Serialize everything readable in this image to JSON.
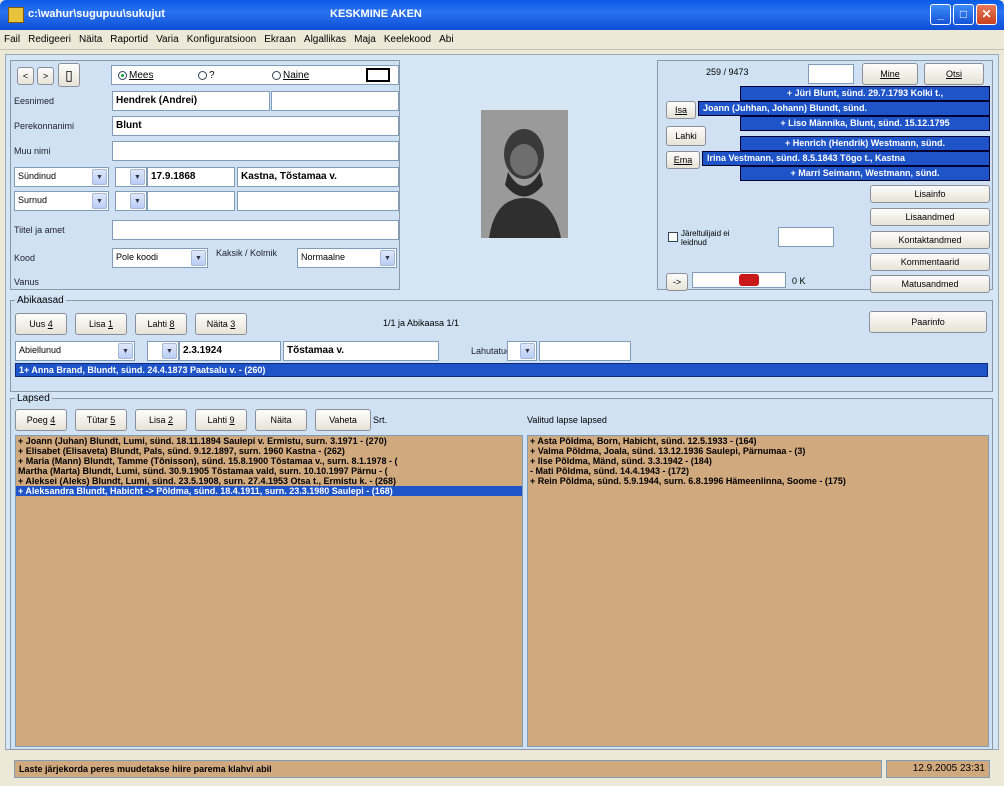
{
  "window": {
    "path": "c:\\wahur\\sugupuu\\sukujut",
    "title": "KESKMINE AKEN",
    "min": "_",
    "max": "□",
    "close": "✕"
  },
  "menu": [
    "Fail",
    "Redigeeri",
    "Näita",
    "Raportid",
    "Varia",
    "Konfiguratsioon",
    "Ekraan",
    "Algallikas",
    "Maja",
    "Keelekood",
    "Abi"
  ],
  "person": {
    "nav_back": "<",
    "nav_fwd": ">",
    "gender_male": "Mees",
    "gender_unknown": "?",
    "gender_female": "Naine",
    "first_names_label": "Eesnimed",
    "first_names": "Hendrek (Andrei)",
    "surname_label": "Perekonnanimi",
    "surname": "Blunt",
    "other_name_label": "Muu nimi",
    "born_combo": "Sündinud",
    "birth_date": "17.9.1868",
    "birth_place": "Kastna, Tõstamaa v.",
    "died_combo": "Surnud",
    "titles_label": "Tiitel ja amet",
    "code_label": "Kood",
    "code_value": "Pole koodi",
    "adopted_label": "Kaksik / Kolmik",
    "adopted_value": "Normaalne",
    "age_label": "Vanus"
  },
  "relatives": {
    "counter": "259 / 9473",
    "go_btn": "Mine",
    "search_btn": "Otsi",
    "father_btn": "Isa",
    "mother_btn": "Ema",
    "spouse_btn": "Lahki",
    "rows": [
      "+ Jüri Blunt, sünd. 29.7.1793 Kolki t.,",
      "Joann (Juhhan, Johann) Blundt, sünd.",
      "+ Liso Männika, Blunt, sünd. 15.12.1795",
      "+ Henrich (Hendrik) Westmann, sünd.",
      "Irina Vestmann, sünd. 8.5.1843 Tõgo t., Kastna",
      "+ Marri Seimann, Westmann, sünd."
    ],
    "no_descendants": "Järeltulijaid ei leidnud",
    "extra_btns": [
      "Lisainfo",
      "Lisaandmed",
      "Kontaktandmed",
      "Kommentaarid",
      "Matusandmed"
    ],
    "arrow": "->",
    "kb": "0 K"
  },
  "marriages": {
    "title": "Abikaasad",
    "new_btn": "Uus",
    "new_key": "4",
    "add_btn": "Lisa",
    "add_key": "1",
    "separate_btn": "Lahti",
    "separate_key": "8",
    "show_btn": "Näita",
    "show_key": "3",
    "status": "1/1 ja Abikaasa 1/1",
    "marital_combo": "Abiellunud",
    "marriage_date": "2.3.1924",
    "marriage_place": "Tõstamaa v.",
    "divorce_label": "Lahutatud",
    "info_btn": "Paarinfo",
    "spouse_row": "1+ Anna Brand, Blundt, sünd. 24.4.1873 Paatsalu v. - (260)"
  },
  "children": {
    "title": "Lapsed",
    "son_btn": "Poeg",
    "son_key": "4",
    "daughter_btn": "Tütar",
    "daughter_key": "5",
    "add_btn": "Lisa",
    "add_key": "2",
    "separate_btn": "Lahti",
    "separate_key": "9",
    "show_btn": "Näita",
    "swap_btn": "Vaheta",
    "swap_suffix": "Srt.",
    "grandchildren_label": "Valitud lapse lapsed",
    "list": [
      "+ Joann (Juhan) Blundt, Lumi, sünd. 18.11.1894 Saulepi v. Ermistu, surn. 3.1971 - (270)",
      "+ Elisabet (Elisaveta) Blundt, Pals, sünd. 9.12.1897, surn. 1960 Kastna - (262)",
      "+ Maria (Mann) Blundt, Tamme (Tõnisson), sünd. 15.8.1900 Tõstamaa v., surn. 8.1.1978 - (",
      "  Martha (Marta) Blundt, Lumi, sünd. 30.9.1905 Tõstamaa vald, surn. 10.10.1997 Pärnu - (",
      "+ Aleksei (Aleks) Blundt, Lumi, sünd. 23.5.1908, surn. 27.4.1953 Otsa t., Ermistu k. - (268)",
      "+ Aleksandra Blundt, Habicht -> Põldma, sünd. 18.4.1911, surn. 23.3.1980 Saulepi - (168)"
    ],
    "grandchildren": [
      "+ Asta Põldma, Born, Habicht, sünd. 12.5.1933 - (164)",
      "+ Valma Põldma, Joala, sünd. 13.12.1936 Saulepi, Pärnumaa - (3)",
      "+ Ilse Põldma, Mänd, sünd. 3.3.1942 - (184)",
      "- Mati Põldma, sünd. 14.4.1943 - (172)",
      "+ Rein Põldma, sünd. 5.9.1944, surn. 6.8.1996 Hämeenlinna, Soome - (175)"
    ]
  },
  "status": {
    "text": "Laste järjekorda peres muudetakse hiire parema klahvi abil",
    "time": "12.9.2005 23:31"
  }
}
